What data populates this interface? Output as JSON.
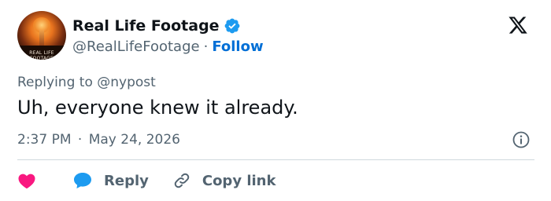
{
  "author": {
    "display_name": "Real Life Footage",
    "handle": "@RealLifeFootage",
    "separator": "·",
    "follow_label": "Follow",
    "avatar_caption": "REAL LIFE FOOTAGE",
    "avatar_icon": "mushroom-cloud-avatar",
    "verified_icon": "verified-badge-icon"
  },
  "brand": {
    "icon": "x-logo-icon",
    "color": "#0f1419"
  },
  "tweet": {
    "replying_to": "Replying to @nypost",
    "text": "Uh, everyone knew it already.",
    "time": "2:37 PM",
    "separator": "·",
    "date": "May 24, 2026"
  },
  "actions": {
    "like_icon": "heart-icon",
    "reply_label": "Reply",
    "reply_icon": "speech-bubble-icon",
    "copy_label": "Copy link",
    "copy_icon": "link-icon"
  },
  "colors": {
    "accent": "#1d9bf0",
    "follow": "#006fd6",
    "like": "#f91880",
    "muted": "#536471",
    "text": "#0f1419",
    "divider": "#cfd9de"
  }
}
